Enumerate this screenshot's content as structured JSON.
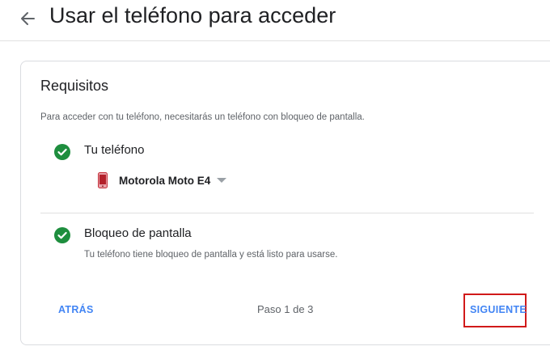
{
  "header": {
    "back_icon": "arrow-left-icon",
    "title": "Usar el teléfono para acceder"
  },
  "card": {
    "title": "Requisitos",
    "description": "Para acceder con tu teléfono, necesitarás un teléfono con bloqueo de pantalla.",
    "items": [
      {
        "icon": "check-circle-icon",
        "label": "Tu teléfono",
        "device": {
          "icon": "phone-icon",
          "name": "Motorola Moto E4"
        }
      },
      {
        "icon": "check-circle-icon",
        "label": "Bloqueo de pantalla",
        "description": "Tu teléfono tiene bloqueo de pantalla y está listo para usarse."
      }
    ],
    "footer": {
      "back_label": "ATRÁS",
      "step": "Paso 1 de 3",
      "next_label": "SIGUIENTE"
    }
  },
  "colors": {
    "accent": "#4285f4",
    "success": "#1e8e3e",
    "highlight": "#d11a1a"
  }
}
